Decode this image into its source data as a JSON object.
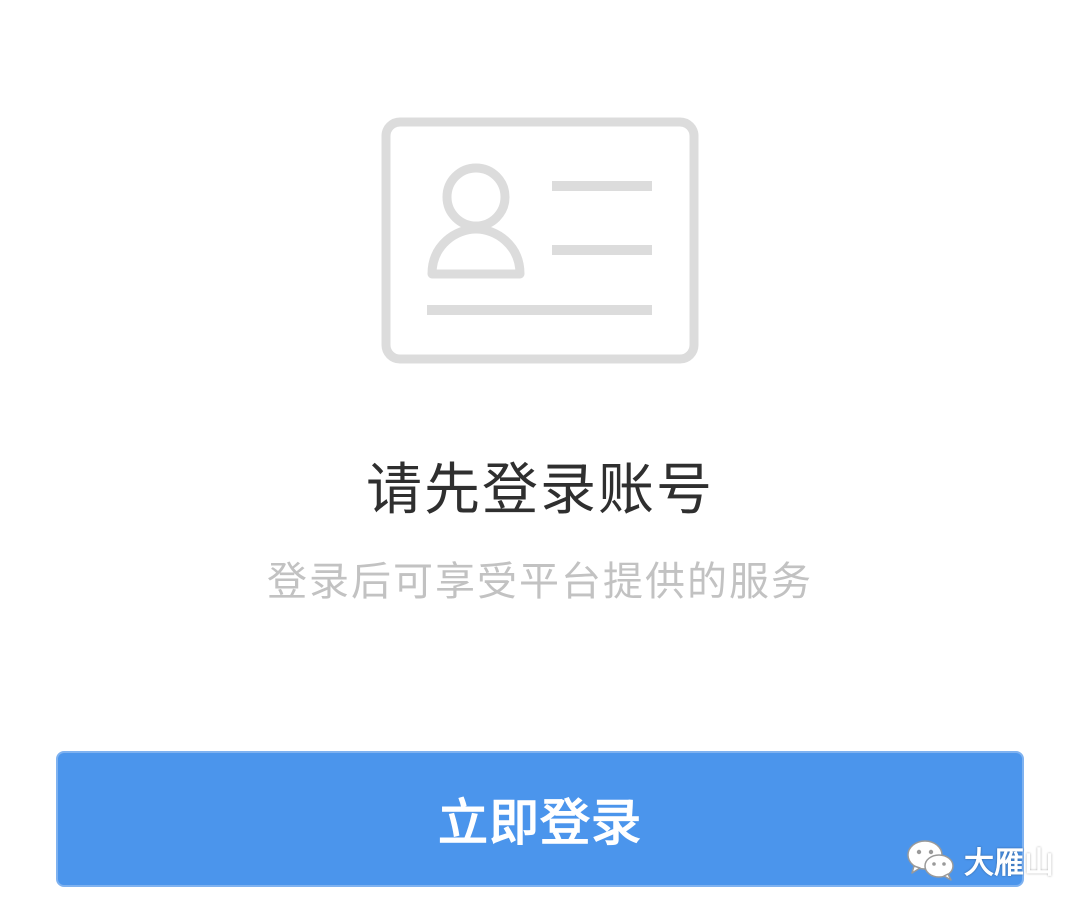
{
  "illustration": {
    "icon": "id-card-icon",
    "color": "#dcdcdc"
  },
  "prompt": {
    "title": "请先登录账号",
    "subtitle": "登录后可享受平台提供的服务"
  },
  "login_button": {
    "label": "立即登录",
    "color": "#4b95ec"
  },
  "watermark": {
    "icon": "wechat-icon",
    "text": "大雁山"
  }
}
